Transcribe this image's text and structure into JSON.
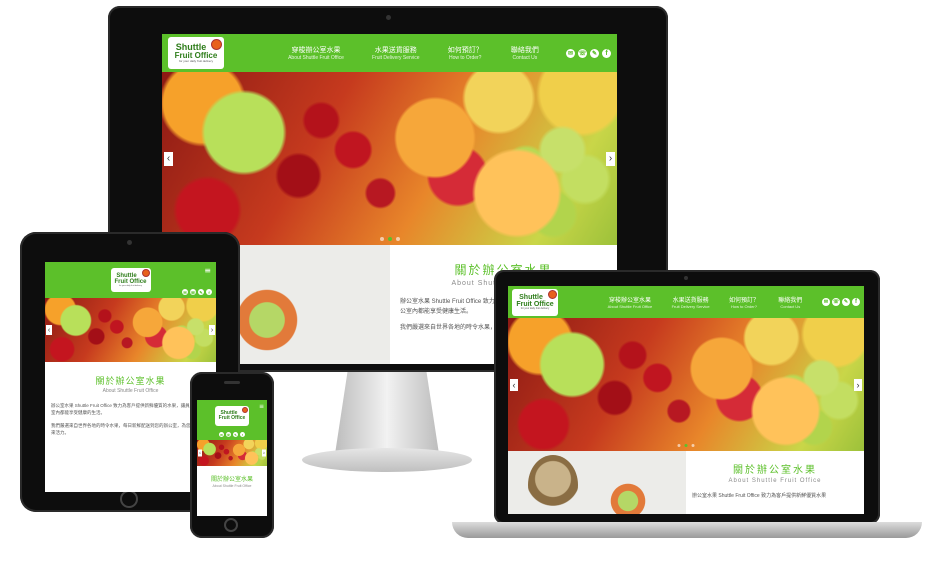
{
  "brand": {
    "line1": "Shuttle",
    "line2": "Fruit Office",
    "tagline": "for your daily fruit delivery"
  },
  "nav": {
    "items": [
      {
        "zh": "穿梭辦公室水果",
        "en": "About Shuttle Fruit Office"
      },
      {
        "zh": "水果送貨服務",
        "en": "Fruit Delivery Service"
      },
      {
        "zh": "如何預訂？",
        "en": "How to Order?"
      },
      {
        "zh": "聯絡我們",
        "en": "Contact Us"
      }
    ],
    "socials": [
      "✉",
      "☏",
      "✎",
      "f"
    ]
  },
  "hero": {
    "prev": "‹",
    "next": "›",
    "slides": 3,
    "active": 1
  },
  "about": {
    "title": "關於辦公室水果",
    "subtitle": "About Shuttle Fruit Office",
    "para_desktop": "辦公室水果 Shuttle Fruit Office 致力為客戶提供新鮮優質的水果，讓員工在辦公室內都能享受健康生活。",
    "para_desktop_2": "我們嚴選來自世界各地的時令水果，每日新鮮配送到您的辦公室。",
    "para_tablet": "辦公室水果 Shuttle Fruit Office 致力為客戶提供新鮮優質的水果，讓員工在辦公室內都能享受健康的生活。",
    "para_tablet_2": "我們嚴選來自世界各地的時令水果，每日新鮮配送到您的辦公室，為您的團隊帶來活力。",
    "para_laptop": "辦公室水果 Shuttle Fruit Office 致力為客戶提供新鮮優質水果"
  },
  "menu_icon": "≡",
  "colors": {
    "brand_green": "#5cc02a",
    "dark_green": "#2e7d1a"
  }
}
